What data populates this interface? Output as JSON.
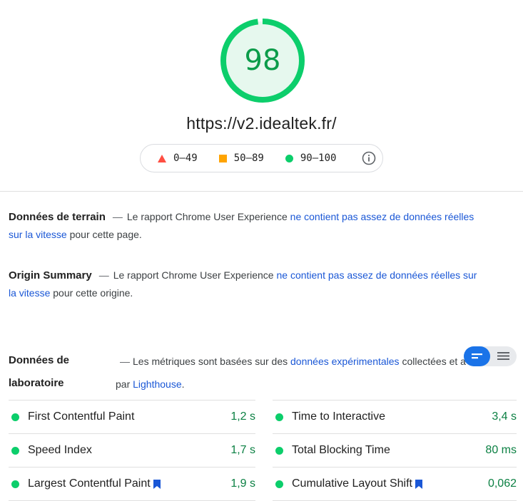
{
  "score": {
    "value": "98",
    "color": "#0cce6b"
  },
  "url": "https://v2.idealtek.fr/",
  "legend": {
    "items": [
      {
        "icon": "red-triangle-icon",
        "label": "0–49",
        "color": "#ff4e42"
      },
      {
        "icon": "orange-square-icon",
        "label": "50–89",
        "color": "#ffa400"
      },
      {
        "icon": "green-circle-icon",
        "label": "90–100",
        "color": "#0cce6b"
      }
    ],
    "info_icon": "info-icon"
  },
  "field_data": {
    "title": "Données de terrain",
    "dash": "—",
    "text_before": "Le rapport Chrome User Experience",
    "link_line1": "ne contient pas assez de données réelles",
    "link_line2": "sur la vitesse",
    "text_after": "pour cette page."
  },
  "origin_summary": {
    "title": "Origin Summary",
    "dash": "—",
    "text_before": "Le rapport Chrome User Experience",
    "link_line1": "ne contient pas assez de données réelles sur",
    "link_line2": "la vitesse",
    "text_after": "pour cette origine."
  },
  "lab_data": {
    "title_line1": "Données de",
    "title_line2": "laboratoire",
    "dash": "—",
    "text_before": "Les métriques sont basées sur des",
    "link": "données expérimentales",
    "text_after": "collectées et a",
    "line2_before": "par",
    "line2_link": "Lighthouse",
    "line2_after": "."
  },
  "view_toggle": {
    "left_icon": "compact-view-icon",
    "right_icon": "list-view-icon",
    "active": "left"
  },
  "metrics": {
    "left": [
      {
        "name": "First Contentful Paint",
        "value": "1,2 s",
        "bookmark": false
      },
      {
        "name": "Speed Index",
        "value": "1,7 s",
        "bookmark": false
      },
      {
        "name": "Largest Contentful Paint",
        "value": "1,9 s",
        "bookmark": true
      }
    ],
    "right": [
      {
        "name": "Time to Interactive",
        "value": "3,4 s",
        "bookmark": false
      },
      {
        "name": "Total Blocking Time",
        "value": "80 ms",
        "bookmark": false
      },
      {
        "name": "Cumulative Layout Shift",
        "value": "0,062",
        "bookmark": true
      }
    ],
    "status_color": "#0cce6b",
    "value_color": "#0b8043"
  }
}
